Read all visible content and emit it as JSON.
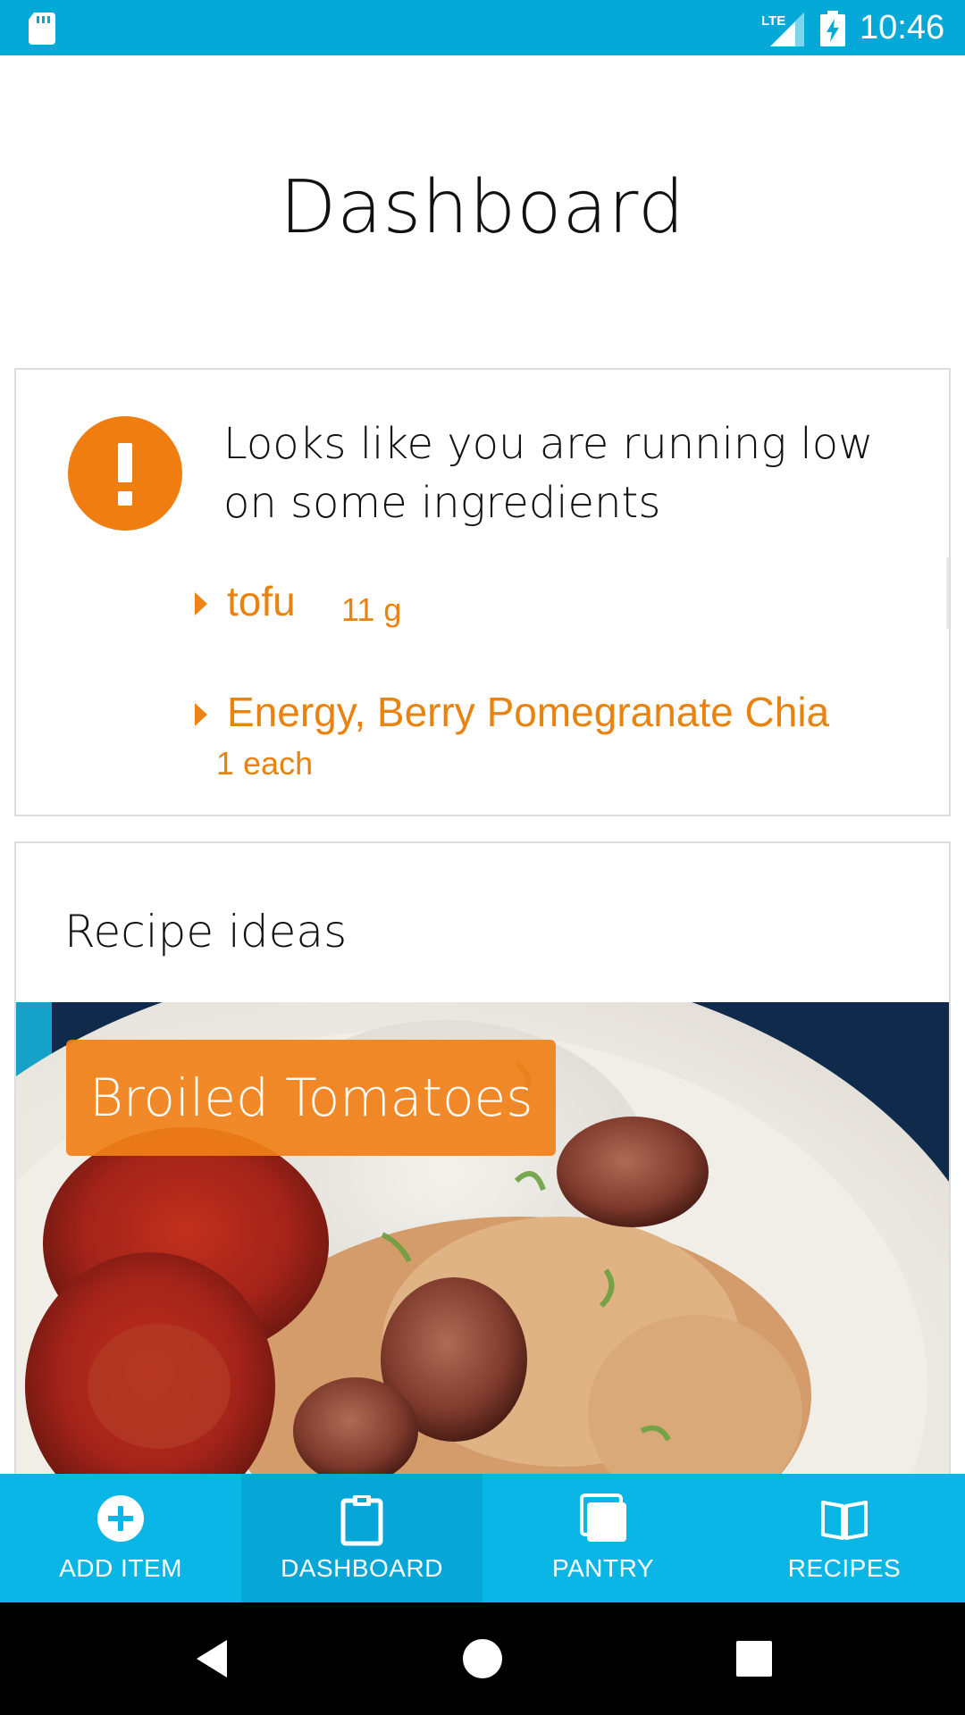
{
  "status_bar": {
    "time": "10:46",
    "network_label": "LTE",
    "icons": [
      "sd-card-icon",
      "lte-signal-icon",
      "battery-charging-icon"
    ]
  },
  "page": {
    "title": "Dashboard"
  },
  "low_stock_card": {
    "message": "Looks like you are running low on some ingredients",
    "icon": "alert-exclamation-icon",
    "items": [
      {
        "name": "tofu",
        "quantity": "11 g"
      },
      {
        "name": "Energy, Berry Pomegranate Chia",
        "quantity": "1 each"
      }
    ]
  },
  "recipes_card": {
    "title": "Recipe ideas",
    "recipes": [
      {
        "name": "Broiled Tomatoes"
      }
    ]
  },
  "bottom_nav": {
    "items": [
      {
        "label": "ADD ITEM",
        "icon": "add-circle-icon",
        "active": false
      },
      {
        "label": "DASHBOARD",
        "icon": "clipboard-icon",
        "active": true
      },
      {
        "label": "PANTRY",
        "icon": "pantry-stack-icon",
        "active": false
      },
      {
        "label": "RECIPES",
        "icon": "book-open-icon",
        "active": false
      }
    ]
  },
  "system_nav": {
    "icons": [
      "back-icon",
      "home-icon",
      "recents-icon"
    ]
  },
  "colors": {
    "status_bar": "#05a9d8",
    "bottom_nav": "#0ab6e6",
    "bottom_nav_active": "#06a6d6",
    "accent_orange": "#f07d0f",
    "text_dark": "#111111"
  }
}
